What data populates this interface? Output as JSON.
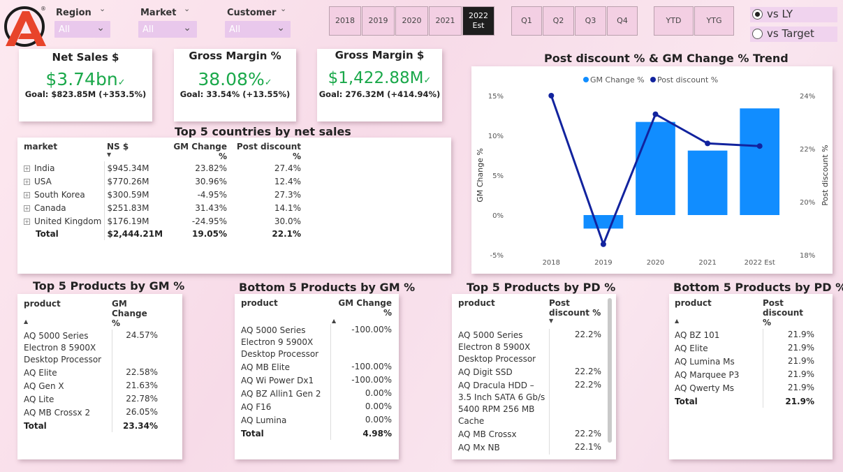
{
  "logo": {
    "name": "atliq-logo",
    "reg_mark": "®"
  },
  "slicers": [
    {
      "title": "Region",
      "value": "All"
    },
    {
      "title": "Market",
      "value": "All"
    },
    {
      "title": "Customer",
      "value": "All"
    }
  ],
  "years": [
    "2018",
    "2019",
    "2020",
    "2021",
    "2022 Est"
  ],
  "active_year": "2022 Est",
  "quarters": [
    "Q1",
    "Q2",
    "Q3",
    "Q4"
  ],
  "ytd": [
    "YTD",
    "YTG"
  ],
  "compare": {
    "options": [
      "vs LY",
      "vs Target"
    ],
    "selected": "vs LY"
  },
  "kpis": [
    {
      "title": "Net Sales $",
      "value": "$3.74bn",
      "goal": "Goal: $823.85M (+353.5%)"
    },
    {
      "title": "Gross Margin %",
      "value": "38.08%",
      "goal": "Goal: 33.54% (+13.55%)"
    },
    {
      "title": "Gross Margin $",
      "value": "$1,422.88M",
      "goal": "Goal: 276.32M (+414.94%)"
    }
  ],
  "countries_table": {
    "title": "Top 5 countries by net sales",
    "headers": [
      "market",
      "NS $",
      "GM Change %",
      "Post discount %"
    ],
    "rows": [
      [
        "India",
        "$945.34M",
        "23.82%",
        "27.4%"
      ],
      [
        "USA",
        "$770.26M",
        "30.96%",
        "12.4%"
      ],
      [
        "South Korea",
        "$300.59M",
        "-4.95%",
        "27.3%"
      ],
      [
        "Canada",
        "$251.83M",
        "31.43%",
        "14.1%"
      ],
      [
        "United Kingdom",
        "$176.19M",
        "-24.95%",
        "30.0%"
      ]
    ],
    "total": [
      "Total",
      "$2,444.21M",
      "19.05%",
      "22.1%"
    ]
  },
  "trend": {
    "title": "Post discount % & GM Change % Trend",
    "legend": [
      "GM Change %",
      "Post discount %"
    ],
    "ylabel_left": "GM Change %",
    "ylabel_right": "Post discount %",
    "left_ticks": [
      "15%",
      "10%",
      "5%",
      "0%",
      "-5%"
    ],
    "right_ticks": [
      "24%",
      "22%",
      "20%",
      "18%"
    ],
    "colors": {
      "bar": "#118DFF",
      "line": "#12239E"
    }
  },
  "chart_data": {
    "type": "bar",
    "categories": [
      "2018",
      "2019",
      "2020",
      "2021",
      "2022 Est"
    ],
    "series": [
      {
        "name": "GM Change %",
        "axis": "left",
        "type": "bar",
        "values": [
          null,
          -1.7,
          11.7,
          8.1,
          13.4
        ]
      },
      {
        "name": "Post discount %",
        "axis": "right",
        "type": "line",
        "values": [
          24.0,
          18.4,
          23.3,
          22.2,
          22.1
        ]
      }
    ],
    "ylim_left": [
      -5,
      15
    ],
    "ylim_right": [
      18,
      24
    ],
    "legend": "top-center"
  },
  "top_gm": {
    "title": "Top 5 Products by GM %",
    "headers": [
      "product",
      "GM Change %"
    ],
    "rows": [
      [
        "AQ 5000 Series Electron 8 5900X Desktop Processor",
        "24.57%"
      ],
      [
        "AQ Elite",
        "22.58%"
      ],
      [
        "AQ Gen X",
        "21.63%"
      ],
      [
        "AQ Lite",
        "22.78%"
      ],
      [
        "AQ MB Crossx 2",
        "26.05%"
      ]
    ],
    "total": [
      "Total",
      "23.34%"
    ]
  },
  "bottom_gm": {
    "title": "Bottom 5 Products by GM %",
    "headers": [
      "product",
      "GM Change %"
    ],
    "rows": [
      [
        "AQ 5000 Series Electron 9 5900X Desktop Processor",
        "-100.00%"
      ],
      [
        "AQ MB Elite",
        "-100.00%"
      ],
      [
        "AQ Wi Power Dx1",
        "-100.00%"
      ],
      [
        "AQ BZ Allin1 Gen 2",
        "0.00%"
      ],
      [
        "AQ F16",
        "0.00%"
      ],
      [
        "AQ Lumina",
        "0.00%"
      ]
    ],
    "total": [
      "Total",
      "4.98%"
    ]
  },
  "top_pd": {
    "title": "Top 5 Products by PD %",
    "headers": [
      "product",
      "Post discount %"
    ],
    "rows": [
      [
        "AQ 5000 Series Electron 8 5900X Desktop Processor",
        "22.2%"
      ],
      [
        "AQ Digit SSD",
        "22.2%"
      ],
      [
        "AQ Dracula HDD – 3.5 Inch SATA 6 Gb/s 5400 RPM 256 MB Cache",
        "22.2%"
      ],
      [
        "AQ MB Crossx",
        "22.2%"
      ],
      [
        "AQ Mx NB",
        "22.1%"
      ]
    ]
  },
  "bottom_pd": {
    "title": "Bottom 5 Products by PD %",
    "headers": [
      "product",
      "Post discount %"
    ],
    "rows": [
      [
        "AQ BZ 101",
        "21.9%"
      ],
      [
        "AQ Elite",
        "21.9%"
      ],
      [
        "AQ Lumina Ms",
        "21.9%"
      ],
      [
        "AQ Marquee P3",
        "21.9%"
      ],
      [
        "AQ Qwerty Ms",
        "21.9%"
      ]
    ],
    "total": [
      "Total",
      "21.9%"
    ]
  }
}
